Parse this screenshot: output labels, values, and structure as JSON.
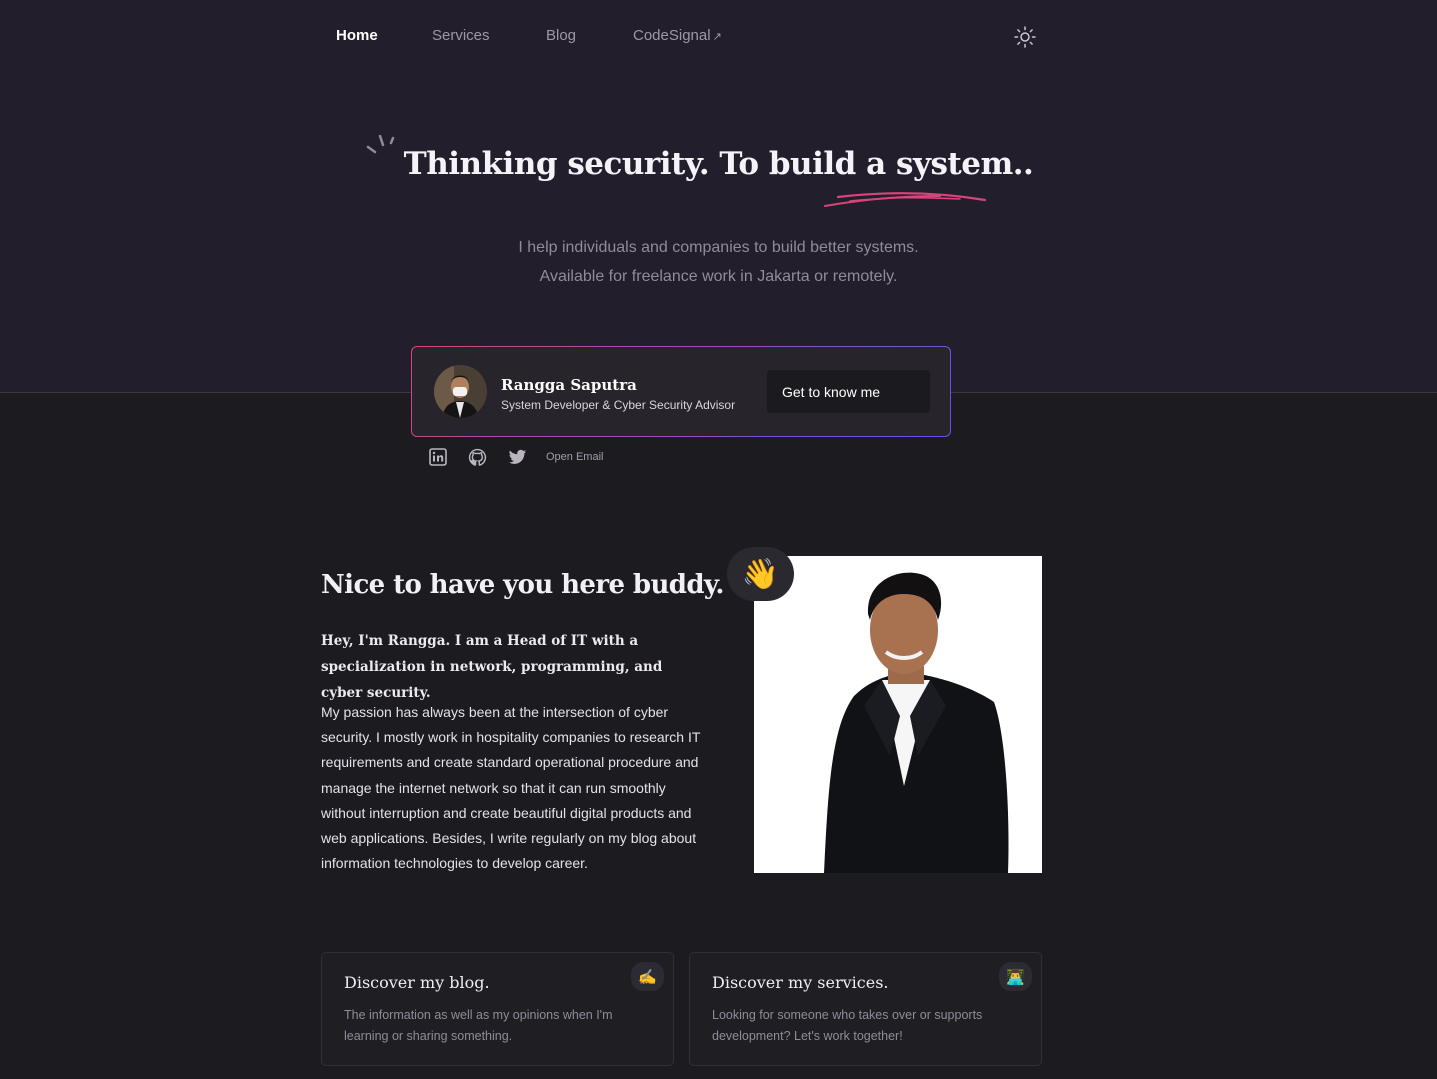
{
  "nav": {
    "items": [
      {
        "label": "Home",
        "active": true
      },
      {
        "label": "Services",
        "active": false
      },
      {
        "label": "Blog",
        "active": false
      },
      {
        "label": "CodeSignal",
        "active": false,
        "external_mark": "↗"
      }
    ],
    "theme_icon": "sun-icon"
  },
  "hero": {
    "title": "Thinking security. To build a system..",
    "subtitle_line1": "I help individuals and companies to build better systems.",
    "subtitle_line2": "Available for freelance work in Jakarta or remotely."
  },
  "profile": {
    "name": "Rangga Saputra",
    "role": "System Developer & Cyber Security Advisor",
    "cta": "Get to know me"
  },
  "social": {
    "icons": [
      "linkedin-icon",
      "github-icon",
      "twitter-icon"
    ],
    "email_label": "Open Email"
  },
  "about": {
    "title": "Nice to have you here buddy.",
    "lead": "Hey, I'm Rangga. I am a Head of IT with a specialization in network, programming, and cyber security.",
    "body": "My passion has always been at the intersection of cyber security. I mostly work in hospitality companies to research IT requirements and create standard operational procedure and manage the internet network so that it can run smoothly without interruption and create beautiful digital products and web applications. Besides, I write regularly on my blog about information technologies to develop career.",
    "wave_emoji": "👋"
  },
  "cards": [
    {
      "title": "Discover my blog.",
      "text": "The information as well as my opinions when I'm learning or sharing something.",
      "emoji": "✍️"
    },
    {
      "title": "Discover my services.",
      "text": "Looking for someone who takes over or supports development? Let's work together!",
      "emoji": "👨‍💻"
    }
  ],
  "colors": {
    "hero_bg": "#231e2c",
    "page_bg": "#1c1b20",
    "accent_pink": "#d8457a",
    "accent_purple": "#6b4de6"
  }
}
